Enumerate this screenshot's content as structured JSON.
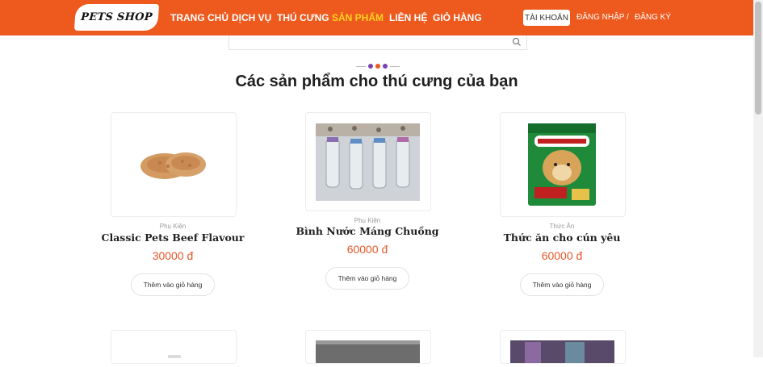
{
  "header": {
    "logo_text": "PETS SHOP",
    "nav": [
      "TRANG CHỦ",
      "DỊCH VỤ",
      "THÚ CƯNG",
      "SẢN PHẨM",
      "LIÊN HỆ",
      "GIỎ HÀNG"
    ],
    "active_nav": "SẢN PHẨM",
    "account_button": "TÀI KHOẢN",
    "login": "ĐĂNG NHẬP",
    "separator": "/",
    "register": "ĐĂNG KÝ"
  },
  "search": {
    "placeholder": "",
    "value": ""
  },
  "heading": "Các sản phẩm cho thú cưng của bạn",
  "products": [
    {
      "category": "Phụ Kiện",
      "name": "Classic Pets Beef Flavour",
      "price": "30000 đ",
      "button": "Thêm vào giỏ hàng"
    },
    {
      "category": "Phụ Kiện",
      "name": "Bình Nước Máng Chuồng",
      "price": "60000 đ",
      "button": "Thêm vào giỏ hàng"
    },
    {
      "category": "Thức Ăn",
      "name": "Thức ăn cho cún yêu",
      "price": "60000 đ",
      "button": "Thêm vào giỏ hàng"
    }
  ],
  "colors": {
    "header_bg": "#ee5a1e",
    "active_nav": "#ffd21f",
    "price": "#e8572a",
    "paw_colors": [
      "#7b3fb0",
      "#ee5a1e",
      "#7b3fb0"
    ]
  }
}
